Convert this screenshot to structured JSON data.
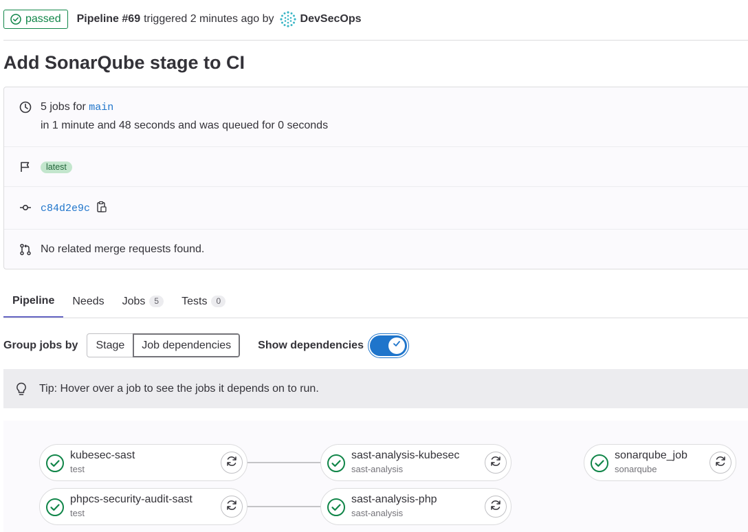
{
  "header": {
    "status": "passed",
    "pipeline_id": "Pipeline #69",
    "triggered": "triggered 2 minutes ago by",
    "user": "DevSecOps"
  },
  "title": "Add SonarQube stage to CI",
  "info": {
    "jobs_prefix": "5 jobs for",
    "branch": "main",
    "duration": "in 1 minute and 48 seconds and was queued for 0 seconds",
    "tag": "latest",
    "commit": "c84d2e9c",
    "merge_requests": "No related merge requests found."
  },
  "tabs": [
    {
      "label": "Pipeline",
      "count": null
    },
    {
      "label": "Needs",
      "count": null
    },
    {
      "label": "Jobs",
      "count": "5"
    },
    {
      "label": "Tests",
      "count": "0"
    }
  ],
  "controls": {
    "group_label": "Group jobs by",
    "stage": "Stage",
    "job_dependencies": "Job dependencies",
    "show_dependencies": "Show dependencies",
    "show_dependencies_on": true
  },
  "tip": "Tip: Hover over a job to see the jobs it depends on to run.",
  "jobs": [
    {
      "name": "kubesec-sast",
      "stage": "test",
      "status": "success"
    },
    {
      "name": "phpcs-security-audit-sast",
      "stage": "test",
      "status": "success"
    },
    {
      "name": "sast-analysis-kubesec",
      "stage": "sast-analysis",
      "status": "success"
    },
    {
      "name": "sast-analysis-php",
      "stage": "sast-analysis",
      "status": "success"
    },
    {
      "name": "sonarqube_job",
      "stage": "sonarqube",
      "status": "success"
    }
  ],
  "colors": {
    "success": "#108548",
    "accent": "#1f75cb",
    "tab_active": "#6666c4"
  }
}
